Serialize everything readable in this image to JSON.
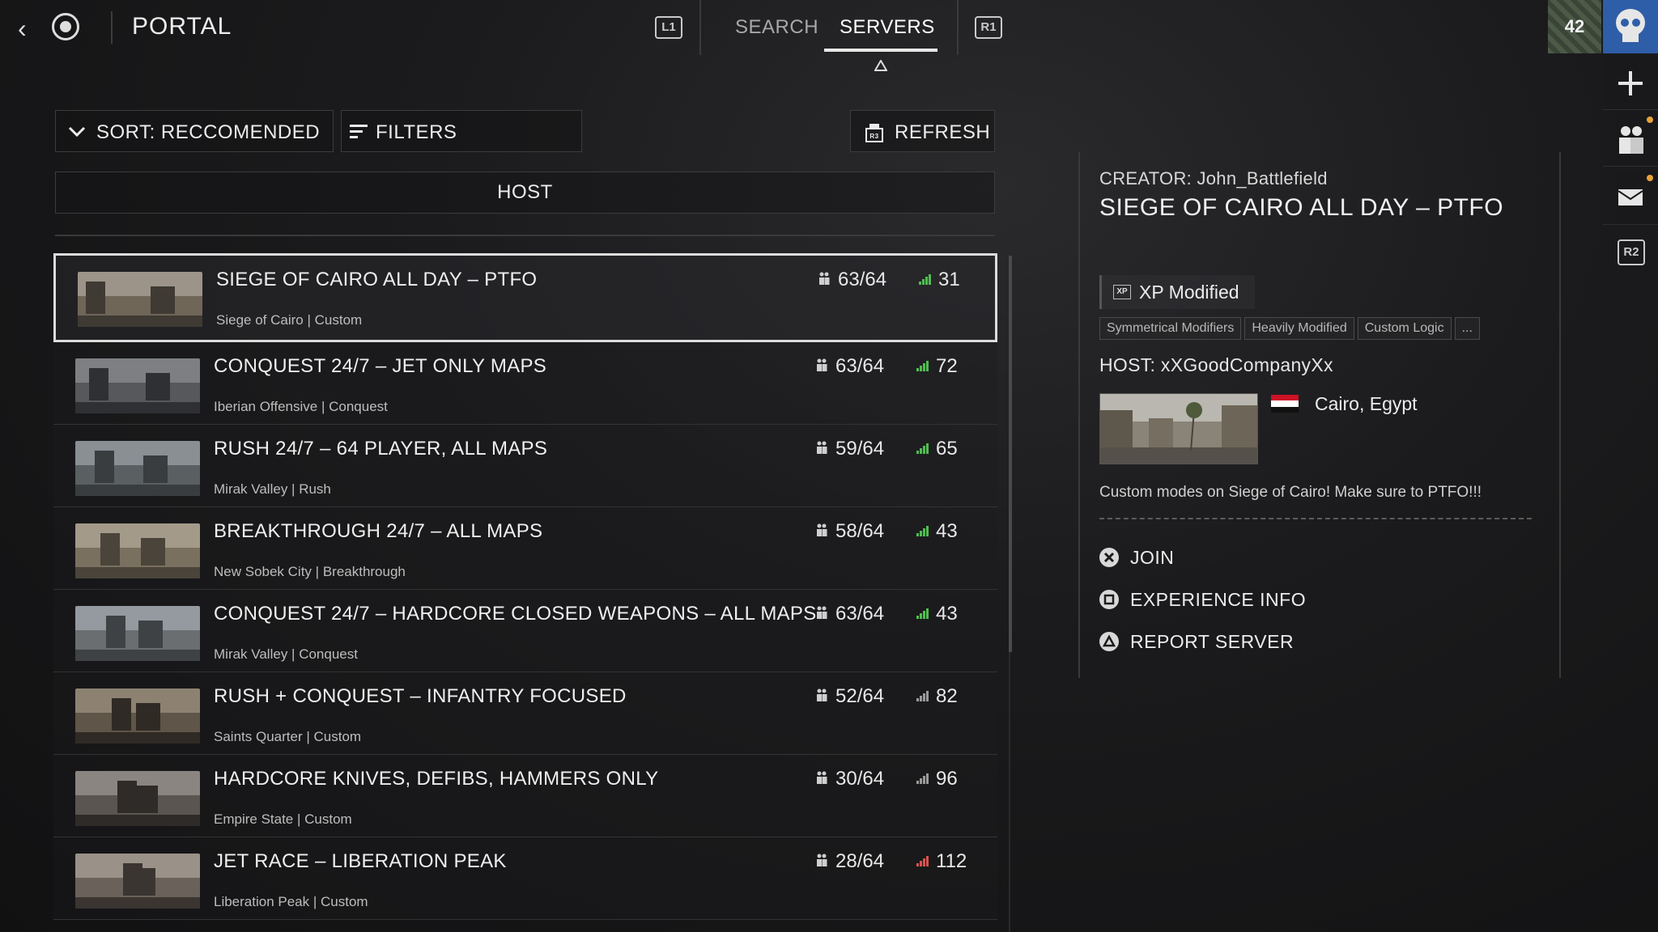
{
  "header": {
    "title": "PORTAL",
    "left_bumper": "L1",
    "right_bumper": "R1",
    "tabs": [
      {
        "label": "SEARCH",
        "active": false
      },
      {
        "label": "SERVERS",
        "active": true
      }
    ]
  },
  "toolbar": {
    "sort_label": "SORT: RECCOMENDED",
    "filters_label": "FILTERS",
    "refresh_label": "REFRESH",
    "host_header": "HOST"
  },
  "servers": [
    {
      "name": "SIEGE OF CAIRO ALL DAY – PTFO",
      "map": "Siege of Cairo",
      "mode": "Custom",
      "players": "63/64",
      "ping": "31",
      "ping_color": "#4fbf4f"
    },
    {
      "name": "CONQUEST 24/7 – JET ONLY MAPS",
      "map": "Iberian Offensive",
      "mode": "Conquest",
      "players": "63/64",
      "ping": "72",
      "ping_color": "#4fbf4f"
    },
    {
      "name": "RUSH 24/7 – 64  PLAYER, ALL MAPS",
      "map": "Mirak Valley",
      "mode": "Rush",
      "players": "59/64",
      "ping": "65",
      "ping_color": "#4fbf4f"
    },
    {
      "name": "BREAKTHROUGH 24/7 – ALL MAPS",
      "map": "New Sobek City",
      "mode": "Breakthrough",
      "players": "58/64",
      "ping": "43",
      "ping_color": "#4fbf4f"
    },
    {
      "name": "CONQUEST 24/7 – HARDCORE CLOSED WEAPONS – ALL MAPS",
      "map": "Mirak Valley",
      "mode": "Conquest",
      "players": "63/64",
      "ping": "43",
      "ping_color": "#4fbf4f"
    },
    {
      "name": "RUSH + CONQUEST – INFANTRY FOCUSED",
      "map": "Saints Quarter",
      "mode": "Custom",
      "players": "52/64",
      "ping": "82",
      "ping_color": "#9a9a9a"
    },
    {
      "name": "HARDCORE KNIVES, DEFIBS, HAMMERS ONLY",
      "map": "Empire State",
      "mode": "Custom",
      "players": "30/64",
      "ping": "96",
      "ping_color": "#9a9a9a"
    },
    {
      "name": "JET RACE – LIBERATION PEAK",
      "map": "Liberation Peak",
      "mode": "Custom",
      "players": "28/64",
      "ping": "112",
      "ping_color": "#d9534f"
    }
  ],
  "detail": {
    "creator": "CREATOR: John_Battlefield",
    "title": "SIEGE OF CAIRO ALL DAY – PTFO",
    "xp_label": "XP Modified",
    "tags": [
      "Symmetrical Modifiers",
      "Heavily Modified",
      "Custom Logic",
      "..."
    ],
    "host": "HOST: xXGoodCompanyXx",
    "location": "Cairo, Egypt",
    "description": "Custom modes on Siege of Cairo! Make sure to PTFO!!!",
    "actions": [
      {
        "label": "JOIN",
        "icon": "cross-button-icon"
      },
      {
        "label": "EXPERIENCE INFO",
        "icon": "square-button-icon"
      },
      {
        "label": "REPORT SERVER",
        "icon": "triangle-button-icon"
      }
    ]
  },
  "rail": {
    "level": "42",
    "r2": "R2"
  }
}
